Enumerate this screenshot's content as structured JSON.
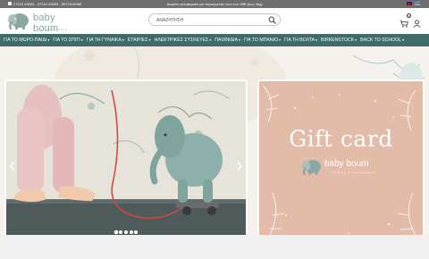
{
  "topbar": {
    "phones": "27210 43004 - 27210 43003 - 6972910085",
    "shipping_notice": "Δωρεάν μεταφορικά για παραγγελίες άνω των 59€ (έως 4kg)",
    "languages": [
      "en",
      "gr"
    ]
  },
  "header": {
    "logo_name": "baby boum",
    "logo_sub": "παιδικα εικονογραφία",
    "search_placeholder": "ΑΝΑΖΗΤΗΣΗ",
    "cart_count": "0",
    "icons": {
      "logo": "elephant-logo-icon",
      "search": "search-icon",
      "cart": "cart-icon",
      "user": "user-icon"
    }
  },
  "nav": {
    "items": [
      {
        "label": "ΓΙΑ ΤΟ ΜΩΡΟ-ΠΑΙΔΙ",
        "has_menu": true
      },
      {
        "label": "ΓΙΑ ΤΟ ΣΠΙΤΙ",
        "has_menu": true
      },
      {
        "label": "ΓΙΑ ΤΗ ΓΥΝΑΙΚΑ",
        "has_menu": true
      },
      {
        "label": "ΕΤΑΙΡΙΕΣ",
        "has_menu": true
      },
      {
        "label": "ΗΛΕΚΤΡΙΚΕΣ ΣΥΣΚΕΥΕΣ",
        "has_menu": true
      },
      {
        "label": "ΠΑΙΧΝΙΔΙΑ",
        "has_menu": true
      },
      {
        "label": "ΓΙΑ ΤΟ ΜΠΑΝΙΟ",
        "has_menu": true
      },
      {
        "label": "ΓΙΑ ΤΗ ΒΟΛΤΑ",
        "has_menu": true
      },
      {
        "label": "BIRKENSTOCK",
        "has_menu": true
      },
      {
        "label": "BACK TO SCHOOL",
        "has_menu": true
      }
    ],
    "caret": "▾"
  },
  "hero": {
    "slider": {
      "slide_count": 5,
      "active_slide": 1,
      "prev_icon": "chevron-left-icon",
      "next_icon": "chevron-right-icon"
    },
    "giftcard": {
      "title": "Gift card",
      "logo_name": "baby boum",
      "logo_sub": "παιδικα εικονογραφία"
    }
  },
  "colors": {
    "topbar": "#6e6e6e",
    "nav": "#3f6b6a",
    "brand": "#8aa7a3",
    "giftcard_bg": "#e2bba9"
  }
}
